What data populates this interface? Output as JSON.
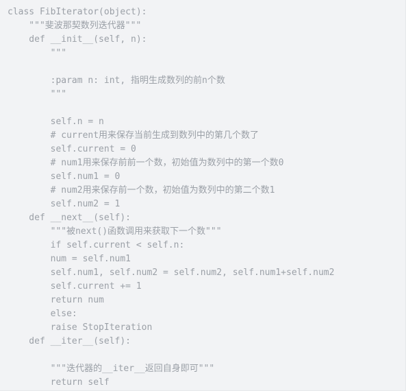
{
  "editor": {
    "language": "python",
    "background_color": "#f2f3f5",
    "text_color": "#9ba0a7",
    "border_color": "#e6e8eb"
  },
  "code": {
    "lines": [
      "class FibIterator(object):",
      "    \"\"\"斐波那契数列迭代器\"\"\"",
      "    def __init__(self, n):",
      "        \"\"\"",
      "",
      "        :param n: int, 指明生成数列的前n个数",
      "        \"\"\"",
      "",
      "        self.n = n",
      "        # current用来保存当前生成到数列中的第几个数了",
      "        self.current = 0",
      "        # num1用来保存前前一个数，初始值为数列中的第一个数0",
      "        self.num1 = 0",
      "        # num2用来保存前一个数，初始值为数列中的第二个数1",
      "        self.num2 = 1",
      "    def __next__(self):",
      "        \"\"\"被next()函数调用来获取下一个数\"\"\"",
      "        if self.current < self.n:",
      "        num = self.num1",
      "        self.num1, self.num2 = self.num2, self.num1+self.num2",
      "        self.current += 1",
      "        return num",
      "        else:",
      "        raise StopIteration",
      "    def __iter__(self):",
      "",
      "        \"\"\"迭代器的__iter__返回自身即可\"\"\"",
      "        return self"
    ]
  }
}
